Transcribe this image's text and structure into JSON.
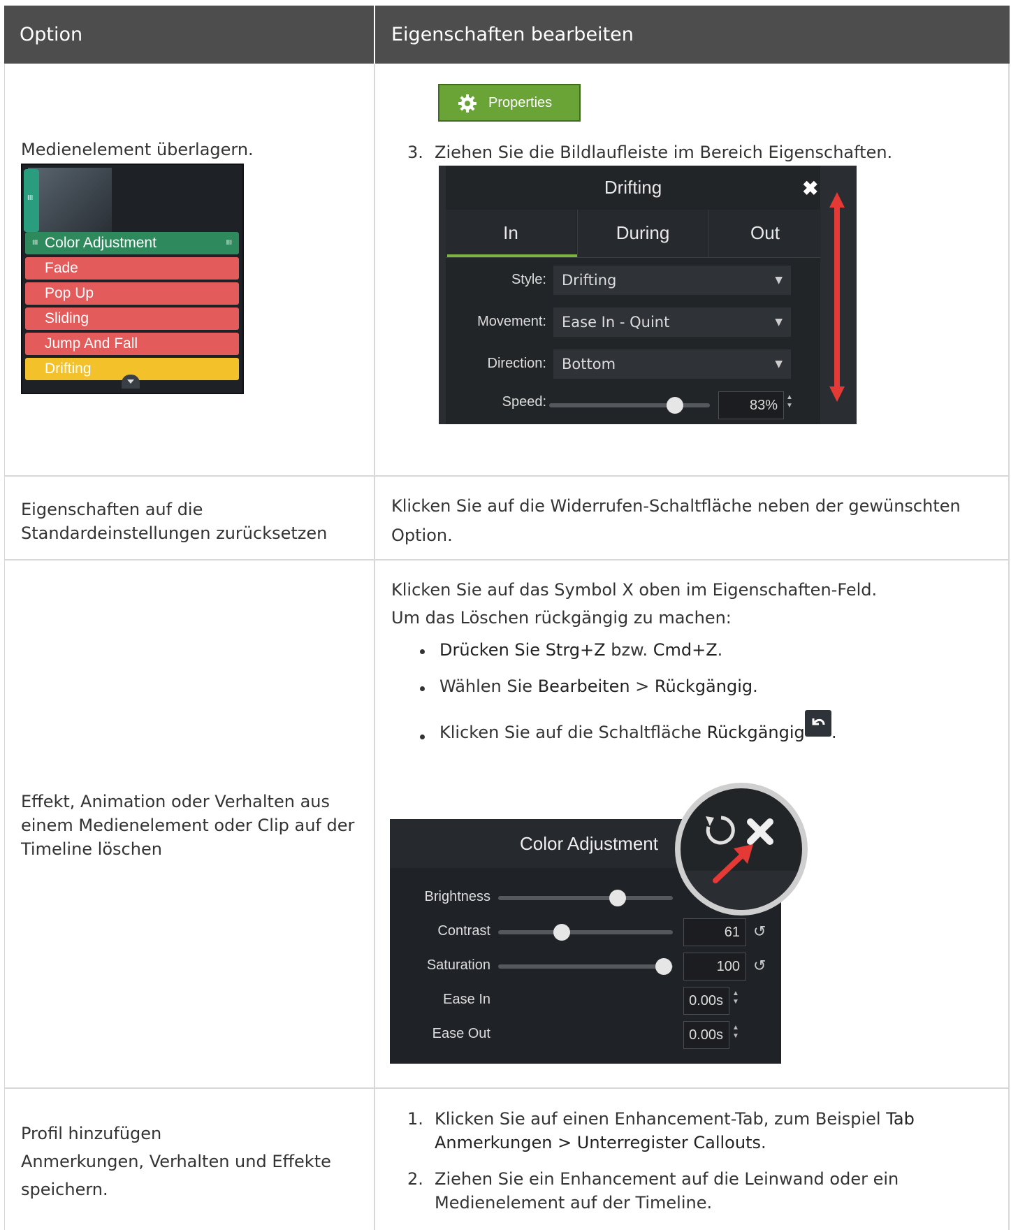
{
  "header": {
    "col1": "Option",
    "col2": "Eigenschaften bearbeiten"
  },
  "row1": {
    "option": "Medienelement überlagern.",
    "button_label": "Properties",
    "step_number": "3.",
    "step_text": "Ziehen Sie die Bildlaufleiste im Bereich Eigenschaften.",
    "timeline": {
      "tracks": [
        "Color Adjustment",
        "Fade",
        "Pop Up",
        "Sliding",
        "Jump And Fall",
        "Drifting"
      ],
      "handle_glyph": "III"
    },
    "panel": {
      "title": "Drifting",
      "close_glyph": "✖",
      "tabs": [
        "In",
        "During",
        "Out"
      ],
      "selected_tab": "In",
      "fields": [
        {
          "label": "Style:",
          "value": "Drifting"
        },
        {
          "label": "Movement:",
          "value": "Ease In - Quint"
        },
        {
          "label": "Direction:",
          "value": "Bottom"
        }
      ],
      "speed_label": "Speed:",
      "speed_value": "83%",
      "accent": "#7cb342",
      "arrow_color": "#e53935"
    }
  },
  "row2": {
    "option_line1": "Eigenschaften auf die",
    "option_line2": "Standardeinstellungen zurücksetzen",
    "desc_line1": "Klicken Sie auf die Widerrufen-Schaltfläche neben der gewünschten",
    "desc_line2": "Option."
  },
  "row3": {
    "option_line1": "Effekt, Animation oder Verhalten aus",
    "option_line2": "einem Medienelement oder Clip auf der",
    "option_line3": "Timeline löschen",
    "desc_line1": "Klicken Sie auf das Symbol X oben im Eigenschaften-Feld.",
    "desc_line2": "Um das Löschen rückgängig zu machen:",
    "bullets": [
      {
        "bold1": "Drücken Sie Strg+Z",
        "mid": " bzw. ",
        "bold2": "Cmd+Z",
        "end": "."
      },
      {
        "pre": "Wählen Sie ",
        "bold1": "Bearbeiten",
        "mid": " > ",
        "bold2": "Rückgängig",
        "end": "."
      },
      {
        "pre": "Klicken Sie auf die Schaltfläche ",
        "bold1": "Rückgängig",
        "end": "."
      }
    ],
    "panel": {
      "title": "Color Adjustment",
      "rows": [
        {
          "label": "Brightness",
          "value": "",
          "level": 0.68
        },
        {
          "label": "Contrast",
          "value": "61",
          "level": 0.38
        },
        {
          "label": "Saturation",
          "value": "100",
          "level": 0.94
        },
        {
          "label": "Ease In",
          "value": "0.00s"
        },
        {
          "label": "Ease Out",
          "value": "0.00s"
        }
      ]
    }
  },
  "row4": {
    "option_line1": "Profil hinzufügen",
    "option_line2": "Anmerkungen, Verhalten und Effekte",
    "option_line3": "speichern.",
    "step1_num": "1.",
    "step1_pre": "Klicken Sie auf einen Enhancement-Tab, zum Beispiel ",
    "step1_bold1": "Tab",
    "step1_bold2": "Anmerkungen > Unterregister Callouts",
    "step1_end": ".",
    "step2_num": "2.",
    "step2_line1": "Ziehen Sie ein Enhancement auf die Leinwand oder ein",
    "step2_line2": "Medienelement auf der Timeline."
  }
}
